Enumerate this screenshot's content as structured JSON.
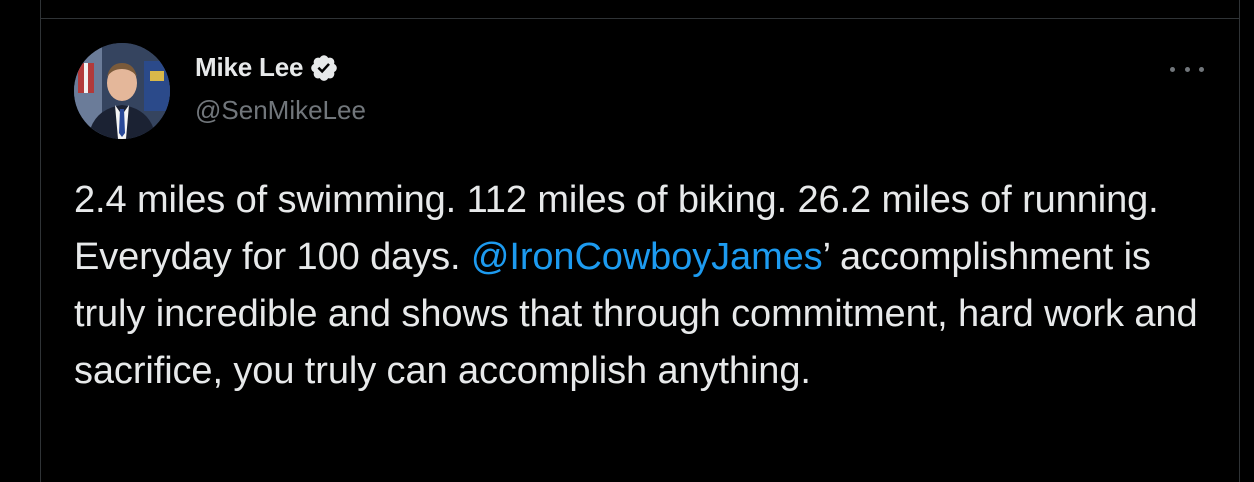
{
  "author": {
    "display_name": "Mike Lee",
    "handle": "@SenMikeLee",
    "verified": true,
    "avatar_icon": "profile-photo-avatar"
  },
  "more_menu": {
    "icon": "more-horizontal-icon"
  },
  "tweet": {
    "text_before_mention": "2.4 miles of swimming. 112 miles of biking. 26.2 miles of running. Everyday for 100 days. ",
    "mention": "@IronCowboyJames",
    "text_after_mention": "’ accomplishment is truly incredible and shows that through commitment, hard work and sacrifice, you truly can accomplish anything."
  },
  "colors": {
    "background": "#000000",
    "text_primary": "#e7e9ea",
    "text_secondary": "#71767b",
    "link": "#1d9bf0",
    "border": "#2f3336"
  }
}
